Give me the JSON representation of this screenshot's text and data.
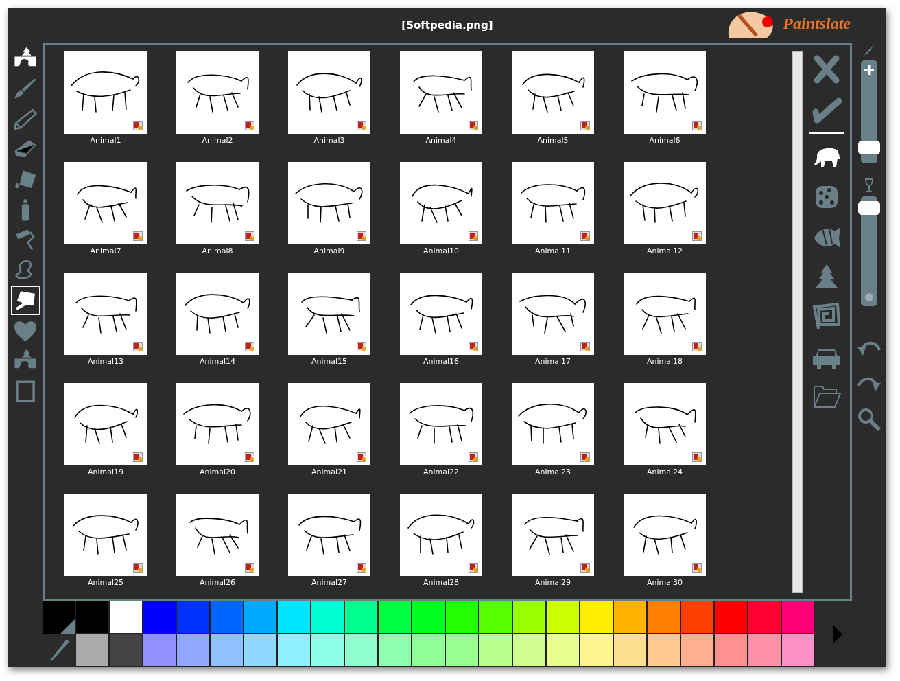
{
  "window": {
    "title": "[Softpedia.png]",
    "logo": "Paintslate"
  },
  "left_tools": [
    {
      "kind": "landscape",
      "selected": false,
      "active": true
    },
    {
      "kind": "brush",
      "selected": false,
      "active": false
    },
    {
      "kind": "pencil",
      "selected": false,
      "active": false
    },
    {
      "kind": "eraser",
      "selected": false,
      "active": false
    },
    {
      "kind": "bucket",
      "selected": false,
      "active": false
    },
    {
      "kind": "spray",
      "selected": false,
      "active": false
    },
    {
      "kind": "roller",
      "selected": false,
      "active": false
    },
    {
      "kind": "stamp",
      "selected": false,
      "active": false
    },
    {
      "kind": "smudge",
      "selected": true,
      "active": true
    },
    {
      "kind": "heart",
      "selected": false,
      "active": false
    },
    {
      "kind": "landscape",
      "selected": false,
      "active": false
    },
    {
      "kind": "frame",
      "selected": false,
      "active": false
    }
  ],
  "thumbnails": [
    {
      "label": "Animal1"
    },
    {
      "label": "Animal2"
    },
    {
      "label": "Animal3"
    },
    {
      "label": "Animal4"
    },
    {
      "label": "Animal5"
    },
    {
      "label": "Animal6"
    },
    {
      "label": "Animal7"
    },
    {
      "label": "Animal8"
    },
    {
      "label": "Animal9"
    },
    {
      "label": "Animal10"
    },
    {
      "label": "Animal11"
    },
    {
      "label": "Animal12"
    },
    {
      "label": "Animal13"
    },
    {
      "label": "Animal14"
    },
    {
      "label": "Animal15"
    },
    {
      "label": "Animal16"
    },
    {
      "label": "Animal17"
    },
    {
      "label": "Animal18"
    },
    {
      "label": "Animal19"
    },
    {
      "label": "Animal20"
    },
    {
      "label": "Animal21"
    },
    {
      "label": "Animal22"
    },
    {
      "label": "Animal23"
    },
    {
      "label": "Animal24"
    },
    {
      "label": "Animal25"
    },
    {
      "label": "Animal26"
    },
    {
      "label": "Animal27"
    },
    {
      "label": "Animal28"
    },
    {
      "label": "Animal29"
    },
    {
      "label": "Animal30"
    }
  ],
  "actions": [
    {
      "kind": "cancel"
    },
    {
      "kind": "confirm"
    }
  ],
  "stamp_tools": [
    {
      "kind": "elephant",
      "selected": true
    },
    {
      "kind": "dice",
      "selected": false
    },
    {
      "kind": "fish",
      "selected": false
    },
    {
      "kind": "tree",
      "selected": false
    },
    {
      "kind": "spiral",
      "selected": false
    },
    {
      "kind": "car",
      "selected": false
    },
    {
      "kind": "folder",
      "selected": false
    }
  ],
  "size_slider": {
    "level": 0.1
  },
  "opacity_slider": {
    "level": 0.95
  },
  "palette_top": [
    {
      "color": "#000000"
    },
    {
      "color": "#ffffff"
    },
    {
      "color": "#0000ff"
    },
    {
      "color": "#0033ff"
    },
    {
      "color": "#0066ff"
    },
    {
      "color": "#00aaff"
    },
    {
      "color": "#00e5ff"
    },
    {
      "color": "#00ffd5"
    },
    {
      "color": "#00ff90"
    },
    {
      "color": "#00ff40"
    },
    {
      "color": "#00ff20"
    },
    {
      "color": "#22ff00"
    },
    {
      "color": "#55ff00"
    },
    {
      "color": "#99ff00"
    },
    {
      "color": "#ccff00"
    },
    {
      "color": "#ffee00"
    },
    {
      "color": "#ffb300"
    },
    {
      "color": "#ff8000"
    },
    {
      "color": "#ff4000"
    },
    {
      "color": "#ff0000"
    },
    {
      "color": "#ff0033"
    },
    {
      "color": "#ff0077"
    }
  ],
  "palette_bottom": [
    {
      "color": "#aaaaaa"
    },
    {
      "color": "#444444"
    },
    {
      "color": "#9090ff"
    },
    {
      "color": "#90a8ff"
    },
    {
      "color": "#90c0ff"
    },
    {
      "color": "#90d8ff"
    },
    {
      "color": "#90f0ff"
    },
    {
      "color": "#90ffe8"
    },
    {
      "color": "#90ffd0"
    },
    {
      "color": "#90ffb0"
    },
    {
      "color": "#90ff98"
    },
    {
      "color": "#98ff90"
    },
    {
      "color": "#b8ff90"
    },
    {
      "color": "#d0ff90"
    },
    {
      "color": "#e8ff90"
    },
    {
      "color": "#fff590"
    },
    {
      "color": "#ffe090"
    },
    {
      "color": "#ffc890"
    },
    {
      "color": "#ffb090"
    },
    {
      "color": "#ff9090"
    },
    {
      "color": "#ff90a8"
    },
    {
      "color": "#ff90c8"
    }
  ]
}
